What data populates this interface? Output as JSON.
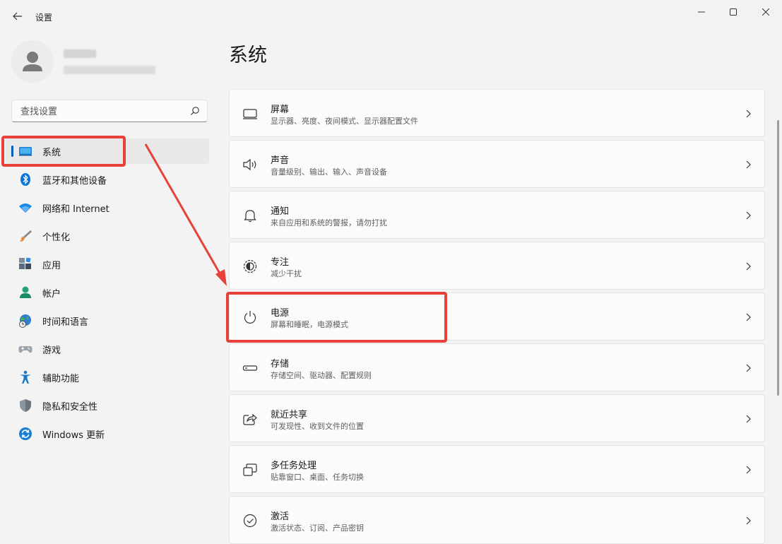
{
  "window": {
    "title": "设置"
  },
  "search": {
    "placeholder": "查找设置"
  },
  "sidebar": {
    "items": [
      {
        "label": "系统",
        "icon": "system-icon",
        "selected": true
      },
      {
        "label": "蓝牙和其他设备",
        "icon": "bluetooth-icon"
      },
      {
        "label": "网络和 Internet",
        "icon": "wifi-icon"
      },
      {
        "label": "个性化",
        "icon": "brush-icon"
      },
      {
        "label": "应用",
        "icon": "apps-icon"
      },
      {
        "label": "帐户",
        "icon": "account-icon"
      },
      {
        "label": "时间和语言",
        "icon": "globe-clock-icon"
      },
      {
        "label": "游戏",
        "icon": "gamepad-icon"
      },
      {
        "label": "辅助功能",
        "icon": "accessibility-icon"
      },
      {
        "label": "隐私和安全性",
        "icon": "shield-icon"
      },
      {
        "label": "Windows 更新",
        "icon": "update-icon"
      }
    ]
  },
  "main": {
    "title": "系统",
    "cards": [
      {
        "title": "屏幕",
        "subtitle": "显示器、亮度、夜间模式、显示器配置文件",
        "icon": "monitor-icon"
      },
      {
        "title": "声音",
        "subtitle": "音量级别、输出、输入、声音设备",
        "icon": "speaker-icon"
      },
      {
        "title": "通知",
        "subtitle": "来自应用和系统的警报，请勿打扰",
        "icon": "bell-icon"
      },
      {
        "title": "专注",
        "subtitle": "减少干扰",
        "icon": "focus-icon"
      },
      {
        "title": "电源",
        "subtitle": "屏幕和睡眠，电源模式",
        "icon": "power-icon"
      },
      {
        "title": "存储",
        "subtitle": "存储空间、驱动器、配置规则",
        "icon": "storage-icon"
      },
      {
        "title": "就近共享",
        "subtitle": "可发现性、收到文件的位置",
        "icon": "share-icon"
      },
      {
        "title": "多任务处理",
        "subtitle": "贴靠窗口、桌面、任务切换",
        "icon": "multitask-icon"
      },
      {
        "title": "激活",
        "subtitle": "激活状态、订阅、产品密钥",
        "icon": "check-circle-icon"
      }
    ]
  },
  "colors": {
    "accent": "#005fb8",
    "annotation": "#e8413a",
    "background": "#f3f3f3",
    "card": "#fbfbfb"
  }
}
